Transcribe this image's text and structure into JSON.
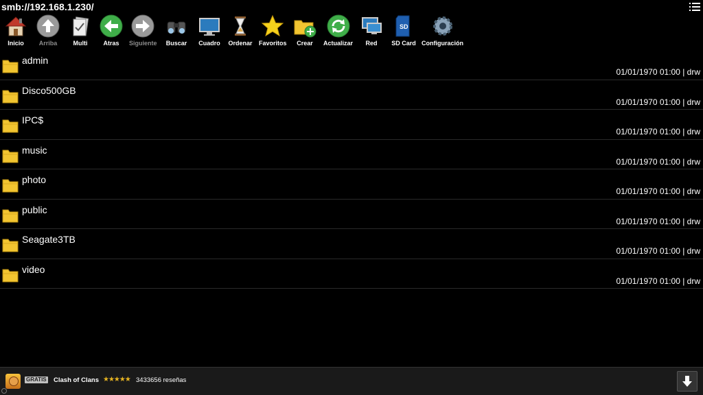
{
  "path": "smb://192.168.1.230/",
  "toolbar": {
    "items": [
      {
        "label": "Inicio",
        "icon": "home-icon"
      },
      {
        "label": "Arriba",
        "icon": "up-arrow-icon",
        "disabled": true
      },
      {
        "label": "Multi",
        "icon": "multi-select-icon"
      },
      {
        "label": "Atras",
        "icon": "back-arrow-icon"
      },
      {
        "label": "Siguiente",
        "icon": "forward-arrow-icon",
        "disabled": true
      },
      {
        "label": "Buscar",
        "icon": "binoculars-icon"
      },
      {
        "label": "Cuadro",
        "icon": "monitor-icon"
      },
      {
        "label": "Ordenar",
        "icon": "hourglass-icon"
      },
      {
        "label": "Favoritos",
        "icon": "star-icon"
      },
      {
        "label": "Crear",
        "icon": "new-folder-icon"
      },
      {
        "label": "Actualizar",
        "icon": "refresh-icon"
      },
      {
        "label": "Red",
        "icon": "network-icon"
      },
      {
        "label": "SD Card",
        "icon": "sd-card-icon"
      },
      {
        "label": "Configuración",
        "icon": "gear-icon"
      }
    ]
  },
  "files": [
    {
      "name": "admin",
      "meta": "01/01/1970 01:00 | drw"
    },
    {
      "name": "Disco500GB",
      "meta": "01/01/1970 01:00 | drw"
    },
    {
      "name": "IPC$",
      "meta": "01/01/1970 01:00 | drw"
    },
    {
      "name": "music",
      "meta": "01/01/1970 01:00 | drw"
    },
    {
      "name": "photo",
      "meta": "01/01/1970 01:00 | drw"
    },
    {
      "name": "public",
      "meta": "01/01/1970 01:00 | drw"
    },
    {
      "name": "Seagate3TB",
      "meta": "01/01/1970 01:00 | drw"
    },
    {
      "name": "video",
      "meta": "01/01/1970 01:00 | drw"
    }
  ],
  "ad": {
    "badge": "GRATIS",
    "title": "Clash of Clans",
    "stars": "★★★★★",
    "rating": 4.5,
    "reviews": "3433656 reseñas"
  },
  "colors": {
    "background": "#000000",
    "folder": "#f2c531",
    "green_button": "#3fae49",
    "disabled_button": "#9a9a9a"
  }
}
